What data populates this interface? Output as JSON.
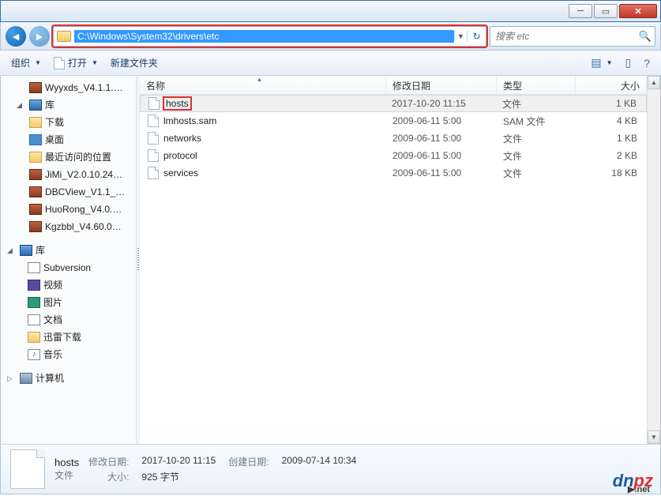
{
  "window": {
    "min_icon": "─",
    "max_icon": "▭",
    "close_icon": "✕"
  },
  "nav": {
    "back_icon": "◄",
    "fwd_icon": "►",
    "path": "C:\\Windows\\System32\\drivers\\etc",
    "refresh_icon": "↻",
    "drop_icon": "▼"
  },
  "search": {
    "placeholder": "搜索 etc",
    "icon": "🔍"
  },
  "toolbar": {
    "organize": "组织",
    "open": "打开",
    "newfolder": "新建文件夹",
    "view_icon": "▤",
    "preview_icon": "▯",
    "help_icon": "?"
  },
  "sidebar": {
    "items_top": [
      {
        "icon": "ic-rar",
        "label": "Wyyxds_V4.1.1.…"
      },
      {
        "icon": "ic-lib",
        "label": "库",
        "tri": "◢"
      },
      {
        "icon": "ic-fldr",
        "label": "下载"
      },
      {
        "icon": "ic-desk",
        "label": "桌面"
      },
      {
        "icon": "ic-fldr",
        "label": "最近访问的位置"
      },
      {
        "icon": "ic-rar",
        "label": "JiMi_V2.0.10.24…"
      },
      {
        "icon": "ic-rar",
        "label": "DBCView_V1.1_…"
      },
      {
        "icon": "ic-rar",
        "label": "HuoRong_V4.0.…"
      },
      {
        "icon": "ic-rar",
        "label": "Kgzbbl_V4.60.0…"
      }
    ],
    "lib_header": "库",
    "libs": [
      {
        "icon": "ic-svn",
        "label": "Subversion"
      },
      {
        "icon": "ic-vid",
        "label": "视频"
      },
      {
        "icon": "ic-img",
        "label": "图片"
      },
      {
        "icon": "ic-doc",
        "label": "文档"
      },
      {
        "icon": "ic-fldr",
        "label": "迅雷下载"
      },
      {
        "icon": "ic-mus",
        "label": "音乐",
        "glyph": "♪"
      }
    ],
    "computer": "计算机",
    "network_icon": "▣"
  },
  "columns": {
    "name": "名称",
    "date": "修改日期",
    "type": "类型",
    "size": "大小",
    "sort": "▲"
  },
  "files": [
    {
      "name": "hosts",
      "date": "2017-10-20 11:15",
      "type": "文件",
      "size": "1 KB",
      "sel": true,
      "hl": true
    },
    {
      "name": "lmhosts.sam",
      "date": "2009-06-11 5:00",
      "type": "SAM 文件",
      "size": "4 KB"
    },
    {
      "name": "networks",
      "date": "2009-06-11 5:00",
      "type": "文件",
      "size": "1 KB"
    },
    {
      "name": "protocol",
      "date": "2009-06-11 5:00",
      "type": "文件",
      "size": "2 KB"
    },
    {
      "name": "services",
      "date": "2009-06-11 5:00",
      "type": "文件",
      "size": "18 KB"
    }
  ],
  "details": {
    "title": "hosts",
    "type": "文件",
    "mod_label": "修改日期:",
    "mod_val": "2017-10-20 11:15",
    "size_label": "大小:",
    "size_val": "925 字节",
    "created_label": "创建日期:",
    "created_val": "2009-07-14 10:34"
  },
  "watermark": {
    "p1": "dn",
    "p2": "pz",
    "sub": "▶.net"
  }
}
